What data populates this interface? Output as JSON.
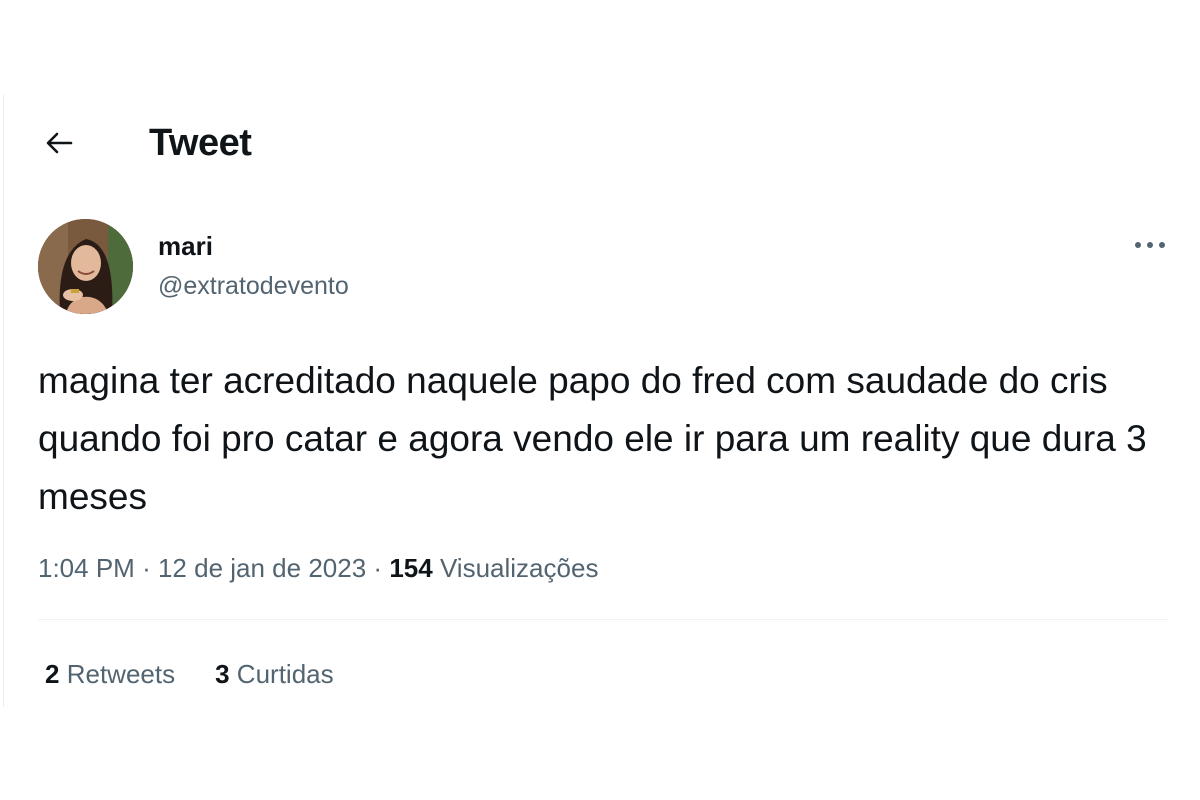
{
  "header": {
    "title": "Tweet",
    "back_icon": "arrow-left-icon"
  },
  "author": {
    "display_name": "mari",
    "handle": "@extratodevento",
    "avatar": "profile-photo"
  },
  "menu": {
    "icon": "more-horizontal-icon"
  },
  "tweet": {
    "text": "magina ter acreditado naquele papo do fred com saudade do cris quando foi pro catar e agora vendo ele ir para um reality que dura 3 meses",
    "time": "1:04 PM",
    "separator": "·",
    "date": "12 de jan de 2023",
    "views_count": "154",
    "views_label": "Visualizações"
  },
  "stats": {
    "retweets_count": "2",
    "retweets_label": "Retweets",
    "likes_count": "3",
    "likes_label": "Curtidas"
  },
  "colors": {
    "text_primary": "#0f1419",
    "text_secondary": "#536471",
    "divider": "#eff3f4"
  }
}
